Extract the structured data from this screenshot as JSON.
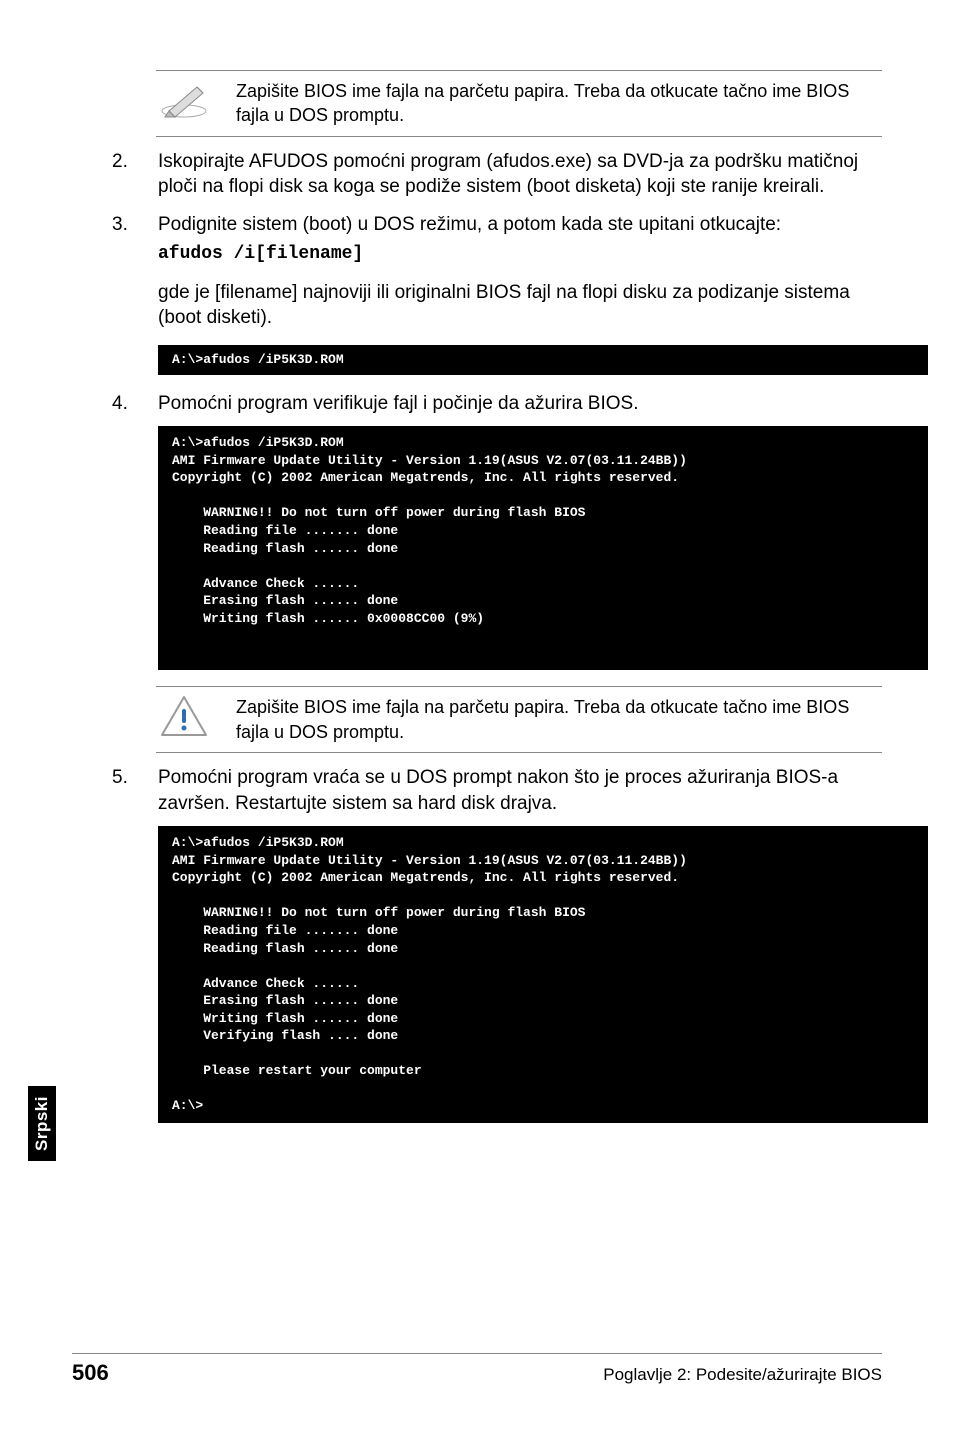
{
  "note1": {
    "text": "Zapišite BIOS ime fajla na parčetu papira. Treba da otkucate tačno ime BIOS fajla u DOS promptu."
  },
  "step2": {
    "num": "2.",
    "body": "Iskopirajte AFUDOS pomoćni program (afudos.exe) sa DVD-ja za podršku matičnoj ploči na flopi disk sa koga se podiže sistem (boot disketa) koji ste ranije kreirali."
  },
  "step3": {
    "num": "3.",
    "body": "Podignite sistem (boot) u DOS režimu, a potom kada ste upitani otkucajte:",
    "cmd": "afudos /i[filename]"
  },
  "subpara3": "gde je [filename] najnoviji ili originalni BIOS fajl na flopi disku za podizanje sistema (boot disketi).",
  "term1": "A:\\>afudos /iP5K3D.ROM",
  "step4": {
    "num": "4.",
    "body": "Pomoćni program verifikuje fajl i počinje da ažurira BIOS."
  },
  "term2": "A:\\>afudos /iP5K3D.ROM\nAMI Firmware Update Utility - Version 1.19(ASUS V2.07(03.11.24BB))\nCopyright (C) 2002 American Megatrends, Inc. All rights reserved.\n\n    WARNING!! Do not turn off power during flash BIOS\n    Reading file ....... done\n    Reading flash ...... done\n\n    Advance Check ......\n    Erasing flash ...... done\n    Writing flash ...... 0x0008CC00 (9%)\n\n\n",
  "note2": {
    "text": "Zapišite BIOS ime fajla na parčetu papira. Treba da otkucate tačno ime BIOS fajla u DOS promptu."
  },
  "step5": {
    "num": "5.",
    "body": "Pomoćni program vraća se u DOS prompt nakon što je proces ažuriranja BIOS-a završen.  Restartujte sistem sa hard disk drajva."
  },
  "term3": "A:\\>afudos /iP5K3D.ROM\nAMI Firmware Update Utility - Version 1.19(ASUS V2.07(03.11.24BB))\nCopyright (C) 2002 American Megatrends, Inc. All rights reserved.\n\n    WARNING!! Do not turn off power during flash BIOS\n    Reading file ....... done\n    Reading flash ...... done\n\n    Advance Check ......\n    Erasing flash ...... done\n    Writing flash ...... done\n    Verifying flash .... done\n\n    Please restart your computer\n\nA:\\>",
  "sidetab": "Srpski",
  "footer": {
    "page": "506",
    "right": "Poglavlje 2: Podesite/ažurirajte BIOS"
  }
}
